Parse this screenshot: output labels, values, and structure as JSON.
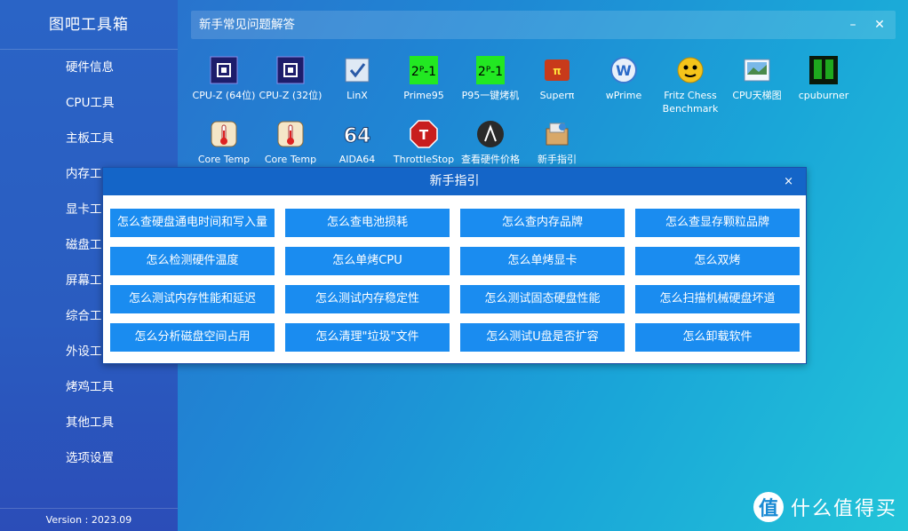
{
  "app": {
    "title": "图吧工具箱",
    "version": "Version : 2023.09"
  },
  "sidebar": {
    "items": [
      {
        "label": "硬件信息"
      },
      {
        "label": "CPU工具"
      },
      {
        "label": "主板工具"
      },
      {
        "label": "内存工"
      },
      {
        "label": "显卡工"
      },
      {
        "label": "磁盘工"
      },
      {
        "label": "屏幕工"
      },
      {
        "label": "综合工"
      },
      {
        "label": "外设工"
      },
      {
        "label": "烤鸡工具"
      },
      {
        "label": "其他工具"
      },
      {
        "label": "选项设置"
      }
    ]
  },
  "header": {
    "title": "新手常见问题解答",
    "minimize": "–",
    "close": "✕"
  },
  "tools": [
    {
      "label": "CPU-Z (64位)",
      "icon": "cpu-z-icon"
    },
    {
      "label": "CPU-Z (32位)",
      "icon": "cpu-z-icon"
    },
    {
      "label": "LinX",
      "icon": "linx-icon"
    },
    {
      "label": "Prime95",
      "icon": "prime95-icon"
    },
    {
      "label": "P95一键烤机",
      "icon": "prime95-icon"
    },
    {
      "label": "Superπ",
      "icon": "superpi-icon"
    },
    {
      "label": "wPrime",
      "icon": "wprime-icon"
    },
    {
      "label": "Fritz Chess",
      "label2": "Benchmark",
      "icon": "fritz-chess-icon"
    },
    {
      "label": "CPU天梯图",
      "icon": "ladder-chart-icon"
    },
    {
      "label": "cpuburner",
      "icon": "cpuburner-icon"
    },
    {
      "label": "Core Temp",
      "icon": "thermometer-icon"
    },
    {
      "label": "Core Temp",
      "icon": "thermometer-icon"
    },
    {
      "label": "AIDA64",
      "icon": "aida64-icon",
      "glyph": "64"
    },
    {
      "label": "ThrottleStop",
      "icon": "throttlestop-icon",
      "glyph": "T"
    },
    {
      "label": "查看硬件价格",
      "icon": "price-icon"
    },
    {
      "label": "新手指引",
      "icon": "guide-icon"
    }
  ],
  "dialog": {
    "title": "新手指引",
    "close": "×",
    "buttons": [
      "怎么查硬盘通电时间和写入量",
      "怎么查电池损耗",
      "怎么查内存品牌",
      "怎么查显存颗粒品牌",
      "怎么检测硬件温度",
      "怎么单烤CPU",
      "怎么单烤显卡",
      "怎么双烤",
      "怎么测试内存性能和延迟",
      "怎么测试内存稳定性",
      "怎么测试固态硬盘性能",
      "怎么扫描机械硬盘坏道",
      "怎么分析磁盘空间占用",
      "怎么清理\"垃圾\"文件",
      "怎么测试U盘是否扩容",
      "怎么卸载软件"
    ]
  },
  "watermark": {
    "logo": "值",
    "text": "什么值得买"
  },
  "colors": {
    "accent": "#1a8cf0",
    "dialog_header": "#1465c8"
  }
}
